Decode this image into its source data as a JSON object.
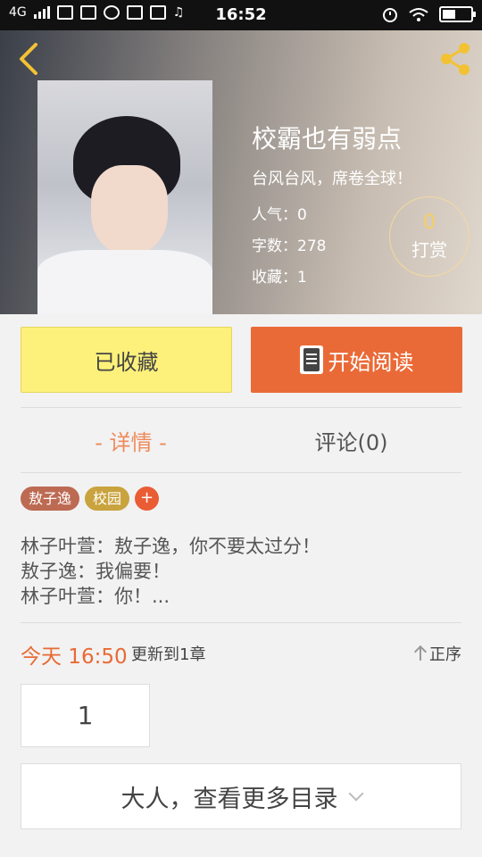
{
  "status_bar": {
    "network": "4G",
    "time": "16:52"
  },
  "book": {
    "title": "校霸也有弱点",
    "subtitle": "台风台风，席卷全球！",
    "popularity": "人气：0",
    "word_count": "字数：278",
    "favorites": "收藏：1",
    "tip_count": "0",
    "tip_label": "打赏"
  },
  "actions": {
    "collected_label": "已收藏",
    "read_label": "开始阅读"
  },
  "tabs": {
    "detail": "- 详情 -",
    "comments": "评论(0)"
  },
  "tags": {
    "items": [
      "敖子逸",
      "校园"
    ],
    "add_symbol": "+"
  },
  "description": {
    "lines": [
      "林子叶萱：敖子逸，你不要太过分！",
      "敖子逸：我偏要！",
      "林子叶萱：你！..."
    ]
  },
  "update": {
    "time": "今天 16:50",
    "text": "更新到1章",
    "order_label": "正序"
  },
  "chapter": {
    "number": "1"
  },
  "more": {
    "label": "大人，查看更多目录"
  },
  "colors": {
    "accent": "#ea6a37",
    "collected_bg": "#fdf17b",
    "tip_number": "#f6cf62"
  },
  "icons": [
    "back-icon",
    "share-icon",
    "book-icon",
    "arrow-up-icon",
    "chevron-down-icon"
  ]
}
